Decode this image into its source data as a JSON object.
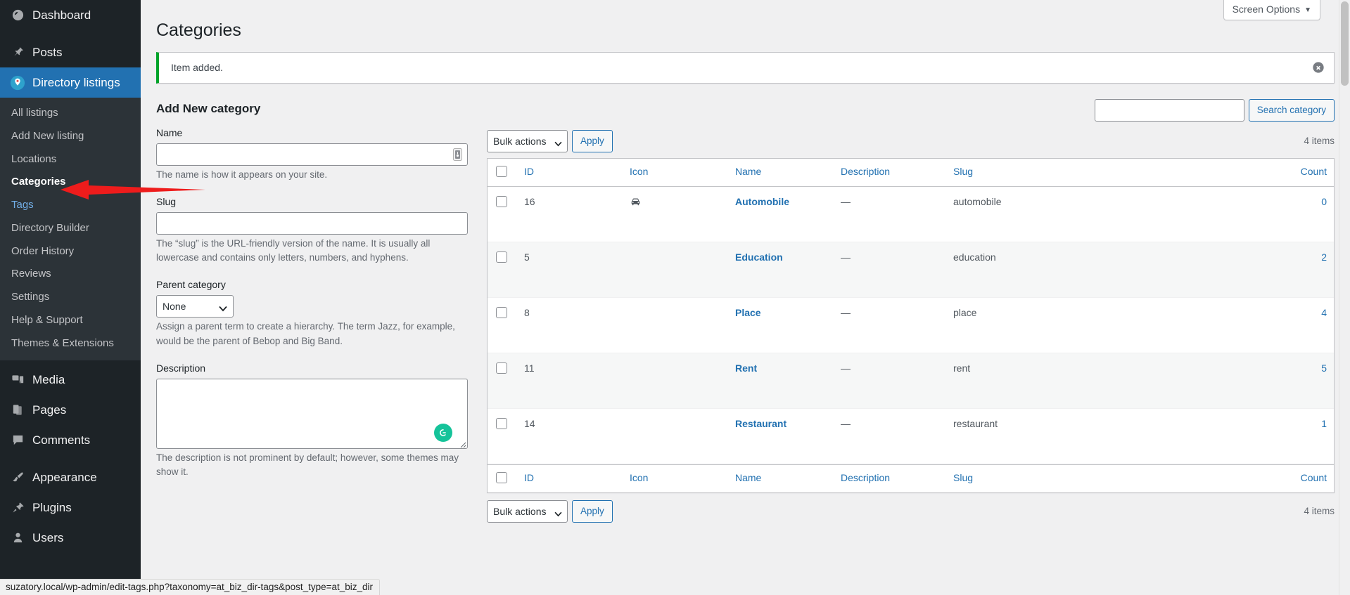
{
  "sidebar": {
    "top_items": [
      {
        "label": "Dashboard",
        "icon": "dashboard-icon",
        "current": false
      },
      {
        "label": "Posts",
        "icon": "pin-icon",
        "current": false
      },
      {
        "label": "Directory listings",
        "icon": "map-marker-icon",
        "current": true
      }
    ],
    "submenu": [
      {
        "label": "All listings",
        "state": "normal"
      },
      {
        "label": "Add New listing",
        "state": "normal"
      },
      {
        "label": "Locations",
        "state": "normal"
      },
      {
        "label": "Categories",
        "state": "current"
      },
      {
        "label": "Tags",
        "state": "hovered"
      },
      {
        "label": "Directory Builder",
        "state": "normal"
      },
      {
        "label": "Order History",
        "state": "normal"
      },
      {
        "label": "Reviews",
        "state": "normal"
      },
      {
        "label": "Settings",
        "state": "normal"
      },
      {
        "label": "Help & Support",
        "state": "normal"
      },
      {
        "label": "Themes & Extensions",
        "state": "normal"
      }
    ],
    "bottom_items": [
      {
        "label": "Media",
        "icon": "media-icon"
      },
      {
        "label": "Pages",
        "icon": "pages-icon"
      },
      {
        "label": "Comments",
        "icon": "comments-icon"
      },
      {
        "label": "Appearance",
        "icon": "paintbrush-icon"
      },
      {
        "label": "Plugins",
        "icon": "plug-icon"
      },
      {
        "label": "Users",
        "icon": "user-icon"
      }
    ]
  },
  "header": {
    "screen_options": "Screen Options",
    "page_title": "Categories"
  },
  "notice": {
    "message": "Item added.",
    "accent_color": "#00a32a"
  },
  "form": {
    "heading": "Add New category",
    "name_label": "Name",
    "name_value": "",
    "name_help": "The name is how it appears on your site.",
    "slug_label": "Slug",
    "slug_value": "",
    "slug_help": "The “slug” is the URL-friendly version of the name. It is usually all lowercase and contains only letters, numbers, and hyphens.",
    "parent_label": "Parent category",
    "parent_selected": "None",
    "parent_options": [
      "None"
    ],
    "parent_help": "Assign a parent term to create a hierarchy. The term Jazz, for example, would be the parent of Bebop and Big Band.",
    "description_label": "Description",
    "description_value": "",
    "description_help": "The description is not prominent by default; however, some themes may show it."
  },
  "search": {
    "value": "",
    "button_label": "Search category"
  },
  "tablenav_top": {
    "bulk_selected": "Bulk actions",
    "bulk_options": [
      "Bulk actions"
    ],
    "apply_label": "Apply",
    "items_count": "4 items"
  },
  "tablenav_bottom": {
    "bulk_selected": "Bulk actions",
    "apply_label": "Apply",
    "items_count": "4 items"
  },
  "table": {
    "columns": [
      "ID",
      "Icon",
      "Name",
      "Description",
      "Slug",
      "Count"
    ],
    "rows": [
      {
        "id": "16",
        "icon": "car-icon",
        "name": "Automobile",
        "description": "—",
        "slug": "automobile",
        "count": "0"
      },
      {
        "id": "5",
        "icon": "",
        "name": "Education",
        "description": "—",
        "slug": "education",
        "count": "2"
      },
      {
        "id": "8",
        "icon": "",
        "name": "Place",
        "description": "—",
        "slug": "place",
        "count": "4"
      },
      {
        "id": "11",
        "icon": "",
        "name": "Rent",
        "description": "—",
        "slug": "rent",
        "count": "5"
      },
      {
        "id": "14",
        "icon": "",
        "name": "Restaurant",
        "description": "—",
        "slug": "restaurant",
        "count": "1"
      }
    ]
  },
  "statusbar": {
    "url": "suzatory.local/wp-admin/edit-tags.php?taxonomy=at_biz_dir-tags&post_type=at_biz_dir"
  },
  "colors": {
    "accent_blue": "#2271b1",
    "sidebar_bg": "#1d2327",
    "submenu_bg": "#2c3338",
    "success_green": "#00a32a",
    "annotation_red": "#ee1c1c",
    "grammarly_green": "#15c39a"
  }
}
